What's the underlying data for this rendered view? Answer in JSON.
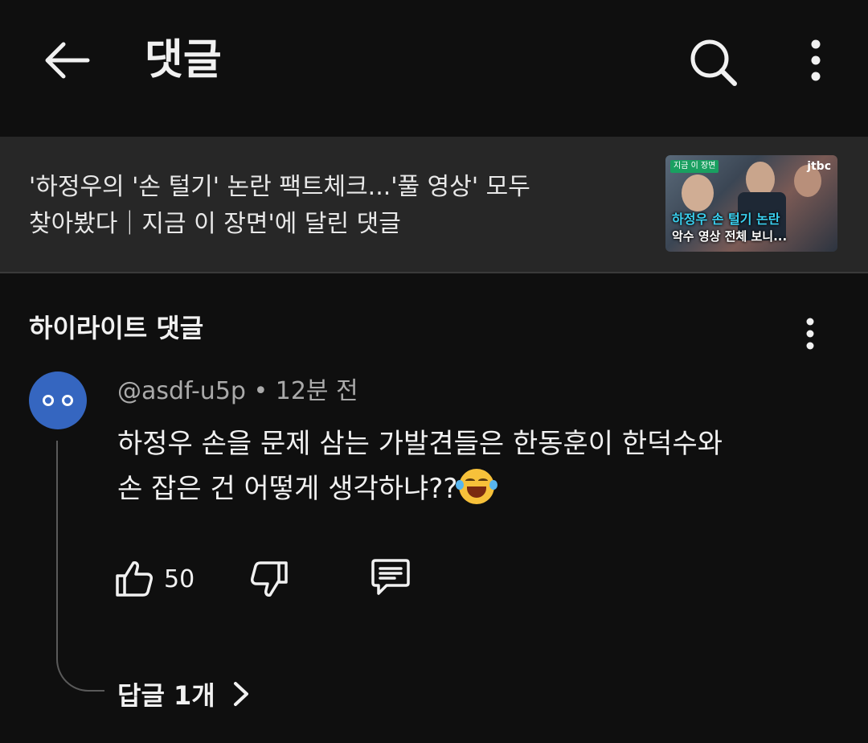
{
  "header": {
    "title": "댓글",
    "icons": {
      "back": "arrow-left-icon",
      "search": "search-icon",
      "more": "more-vertical-icon"
    }
  },
  "video": {
    "title_line1": "'하정우의 '손 털기' 논란 팩트체크...'풀 영상' 모두",
    "title_line2": "찾아봤다｜지금 이 장면'에 달린 댓글",
    "thumbnail": {
      "tag": "지금 이 장면",
      "logo": "jtbc",
      "caption_line1": "하정우 손 털기 논란",
      "caption_line2": "악수 영상 전체 보니..."
    }
  },
  "highlight": {
    "section_title": "하이라이트 댓글",
    "comment": {
      "author": "@asdf-u5p",
      "separator": "•",
      "time": "12분 전",
      "text_line1": "하정우 손을 문제 삼는 가발견들은 한동훈이 한덕수와",
      "text_line2": "손 잡은 건 어떻게 생각하냐??",
      "emoji": "face-with-tears-of-joy",
      "like_count": "50",
      "replies_label": "답글 1개"
    }
  },
  "colors": {
    "background": "#0f0f0f",
    "banner": "#272727",
    "avatar": "#3566c0",
    "secondary_text": "#aaaaaa"
  }
}
